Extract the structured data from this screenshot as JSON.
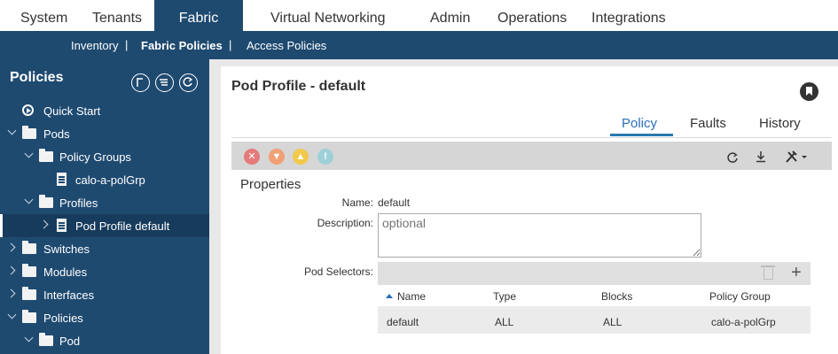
{
  "topnav": {
    "tabs": [
      "System",
      "Tenants",
      "Fabric",
      "Virtual Networking",
      "Admin",
      "Operations",
      "Integrations"
    ],
    "active": "Fabric"
  },
  "subnav": {
    "items": [
      "Inventory",
      "Fabric Policies",
      "Access Policies"
    ],
    "separator": "|"
  },
  "sidebar": {
    "title": "Policies",
    "tree": [
      {
        "label": "Quick Start"
      },
      {
        "label": "Pods"
      },
      {
        "label": "Policy Groups"
      },
      {
        "label": "calo-a-polGrp"
      },
      {
        "label": "Profiles"
      },
      {
        "label": "Pod Profile default"
      },
      {
        "label": "Switches"
      },
      {
        "label": "Modules"
      },
      {
        "label": "Interfaces"
      },
      {
        "label": "Policies"
      },
      {
        "label": "Pod"
      }
    ]
  },
  "main": {
    "title": "Pod Profile - default",
    "tabs": [
      "Policy",
      "Faults",
      "History"
    ],
    "active_tab": "Policy",
    "section": "Properties",
    "fields": {
      "name_label": "Name:",
      "name_value": "default",
      "description_label": "Description:",
      "description_placeholder": "optional",
      "pod_selectors_label": "Pod Selectors:"
    },
    "table": {
      "headers": [
        "Name",
        "Type",
        "Blocks",
        "Policy Group"
      ],
      "rows": [
        [
          "default",
          "ALL",
          "ALL",
          "calo-a-polGrp"
        ]
      ]
    },
    "severity_icons": [
      {
        "name": "critical",
        "color": "#e57a7a"
      },
      {
        "name": "major",
        "color": "#f0a074"
      },
      {
        "name": "minor",
        "color": "#f2c94c"
      },
      {
        "name": "warning",
        "color": "#9ed0d8"
      }
    ]
  }
}
